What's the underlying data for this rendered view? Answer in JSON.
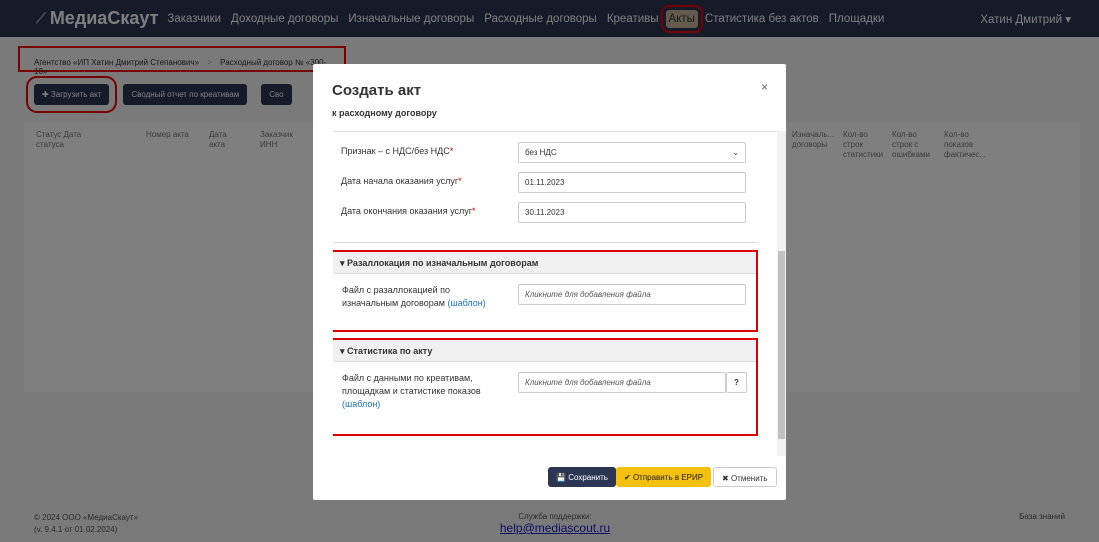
{
  "nav": {
    "brand": "МедиаСкаут",
    "items": [
      "Заказчики",
      "Доходные договоры",
      "Изначальные договоры",
      "Расходные договоры",
      "Креативы",
      "Акты",
      "Статистика без актов",
      "Площадки"
    ],
    "user": "Хатин Дмитрий ▾"
  },
  "breadcrumb": {
    "agency": "Агентство «ИП Хатин Дмитрий Степанович»",
    "sep": ">",
    "contract": "Расходный договор № «300-10»"
  },
  "toolbar": {
    "upload": "✚ Загрузить акт",
    "summary": "Сводный отчет по креативам",
    "third": "Сво"
  },
  "table": {
    "headers": [
      "Статус Дата статуса",
      "Номер акта",
      "Дата акта",
      "Заказчик ИНН",
      "Изначаль... договоры",
      "Кол-во строк статистики",
      "Кол-во строк с ошибками",
      "Кол-во показов фактичес..."
    ]
  },
  "footer": {
    "copyright": "© 2024 ООО «МедиаСкаут»",
    "version": "(v. 9.4.1 от 01.02.2024)",
    "support": "Служба поддержки:",
    "email": "help@mediascout.ru",
    "kb": "База знаний"
  },
  "modal": {
    "title": "Создать акт",
    "subtitle": "к расходному договору",
    "vat_label": "Признак – с НДС/без НДС",
    "vat_value": "без НДС",
    "start_label": "Дата начала оказания услуг",
    "start_value": "01.11.2023",
    "end_label": "Дата окончания оказания услуг",
    "end_value": "30.11.2023",
    "realloc": {
      "title": "Разаллокация по изначальным договорам",
      "label1": "Файл с разаллокацией по",
      "label2": "изначальным договорам",
      "template": "(шаблон)",
      "placeholder": "Кликните для добавления файла"
    },
    "stats": {
      "title": "Статистика по акту",
      "label1": "Файл с данными по креативам,",
      "label2": "площадкам и статистике показов",
      "template": "(шаблон)",
      "placeholder": "Кликните для добавления файла",
      "help": "?"
    },
    "save": "Сохранить",
    "send": "Отправить в ЕРИР",
    "cancel": "Отменить"
  }
}
